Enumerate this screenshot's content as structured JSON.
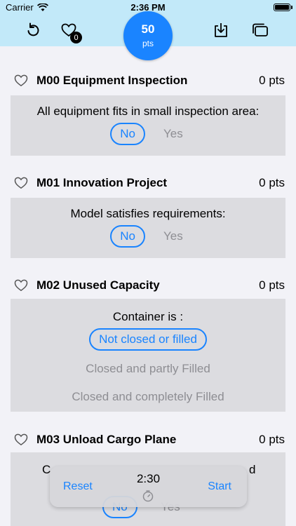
{
  "status_bar": {
    "carrier": "Carrier",
    "time": "2:36 PM"
  },
  "toolbar": {
    "favorites_count": "0",
    "score_value": "50",
    "score_unit": "pts",
    "icons": [
      "reset-icon",
      "heart-icon",
      "download-icon",
      "windows-icon"
    ]
  },
  "missions": [
    {
      "title": "M00 Equipment Inspection",
      "points": "0  pts",
      "question": "All equipment fits in small inspection area:",
      "options": [
        "No",
        "Yes"
      ],
      "selected": "No"
    },
    {
      "title": "M01 Innovation Project",
      "points": "0  pts",
      "question": "Model satisfies requirements:",
      "options": [
        "No",
        "Yes"
      ],
      "selected": "No"
    },
    {
      "title": "M02 Unused Capacity",
      "points": "0  pts",
      "question": "Container is :",
      "options": [
        "Not closed or filled",
        "Closed and partly Filled",
        "Closed and completely Filled"
      ],
      "selected": "Not closed or filled"
    },
    {
      "title": "M03 Unload Cargo Plane",
      "points": "0  pts",
      "question": "C",
      "question_tail": "d",
      "options": [
        "No",
        "Yes"
      ],
      "selected": "No"
    }
  ],
  "timer": {
    "reset_label": "Reset",
    "time": "2:30",
    "start_label": "Start"
  },
  "colors": {
    "accent": "#1a84ff",
    "toolbar_bg": "#c2e9f9",
    "panel_bg": "#dcdce0",
    "inactive": "#8e8e93"
  }
}
